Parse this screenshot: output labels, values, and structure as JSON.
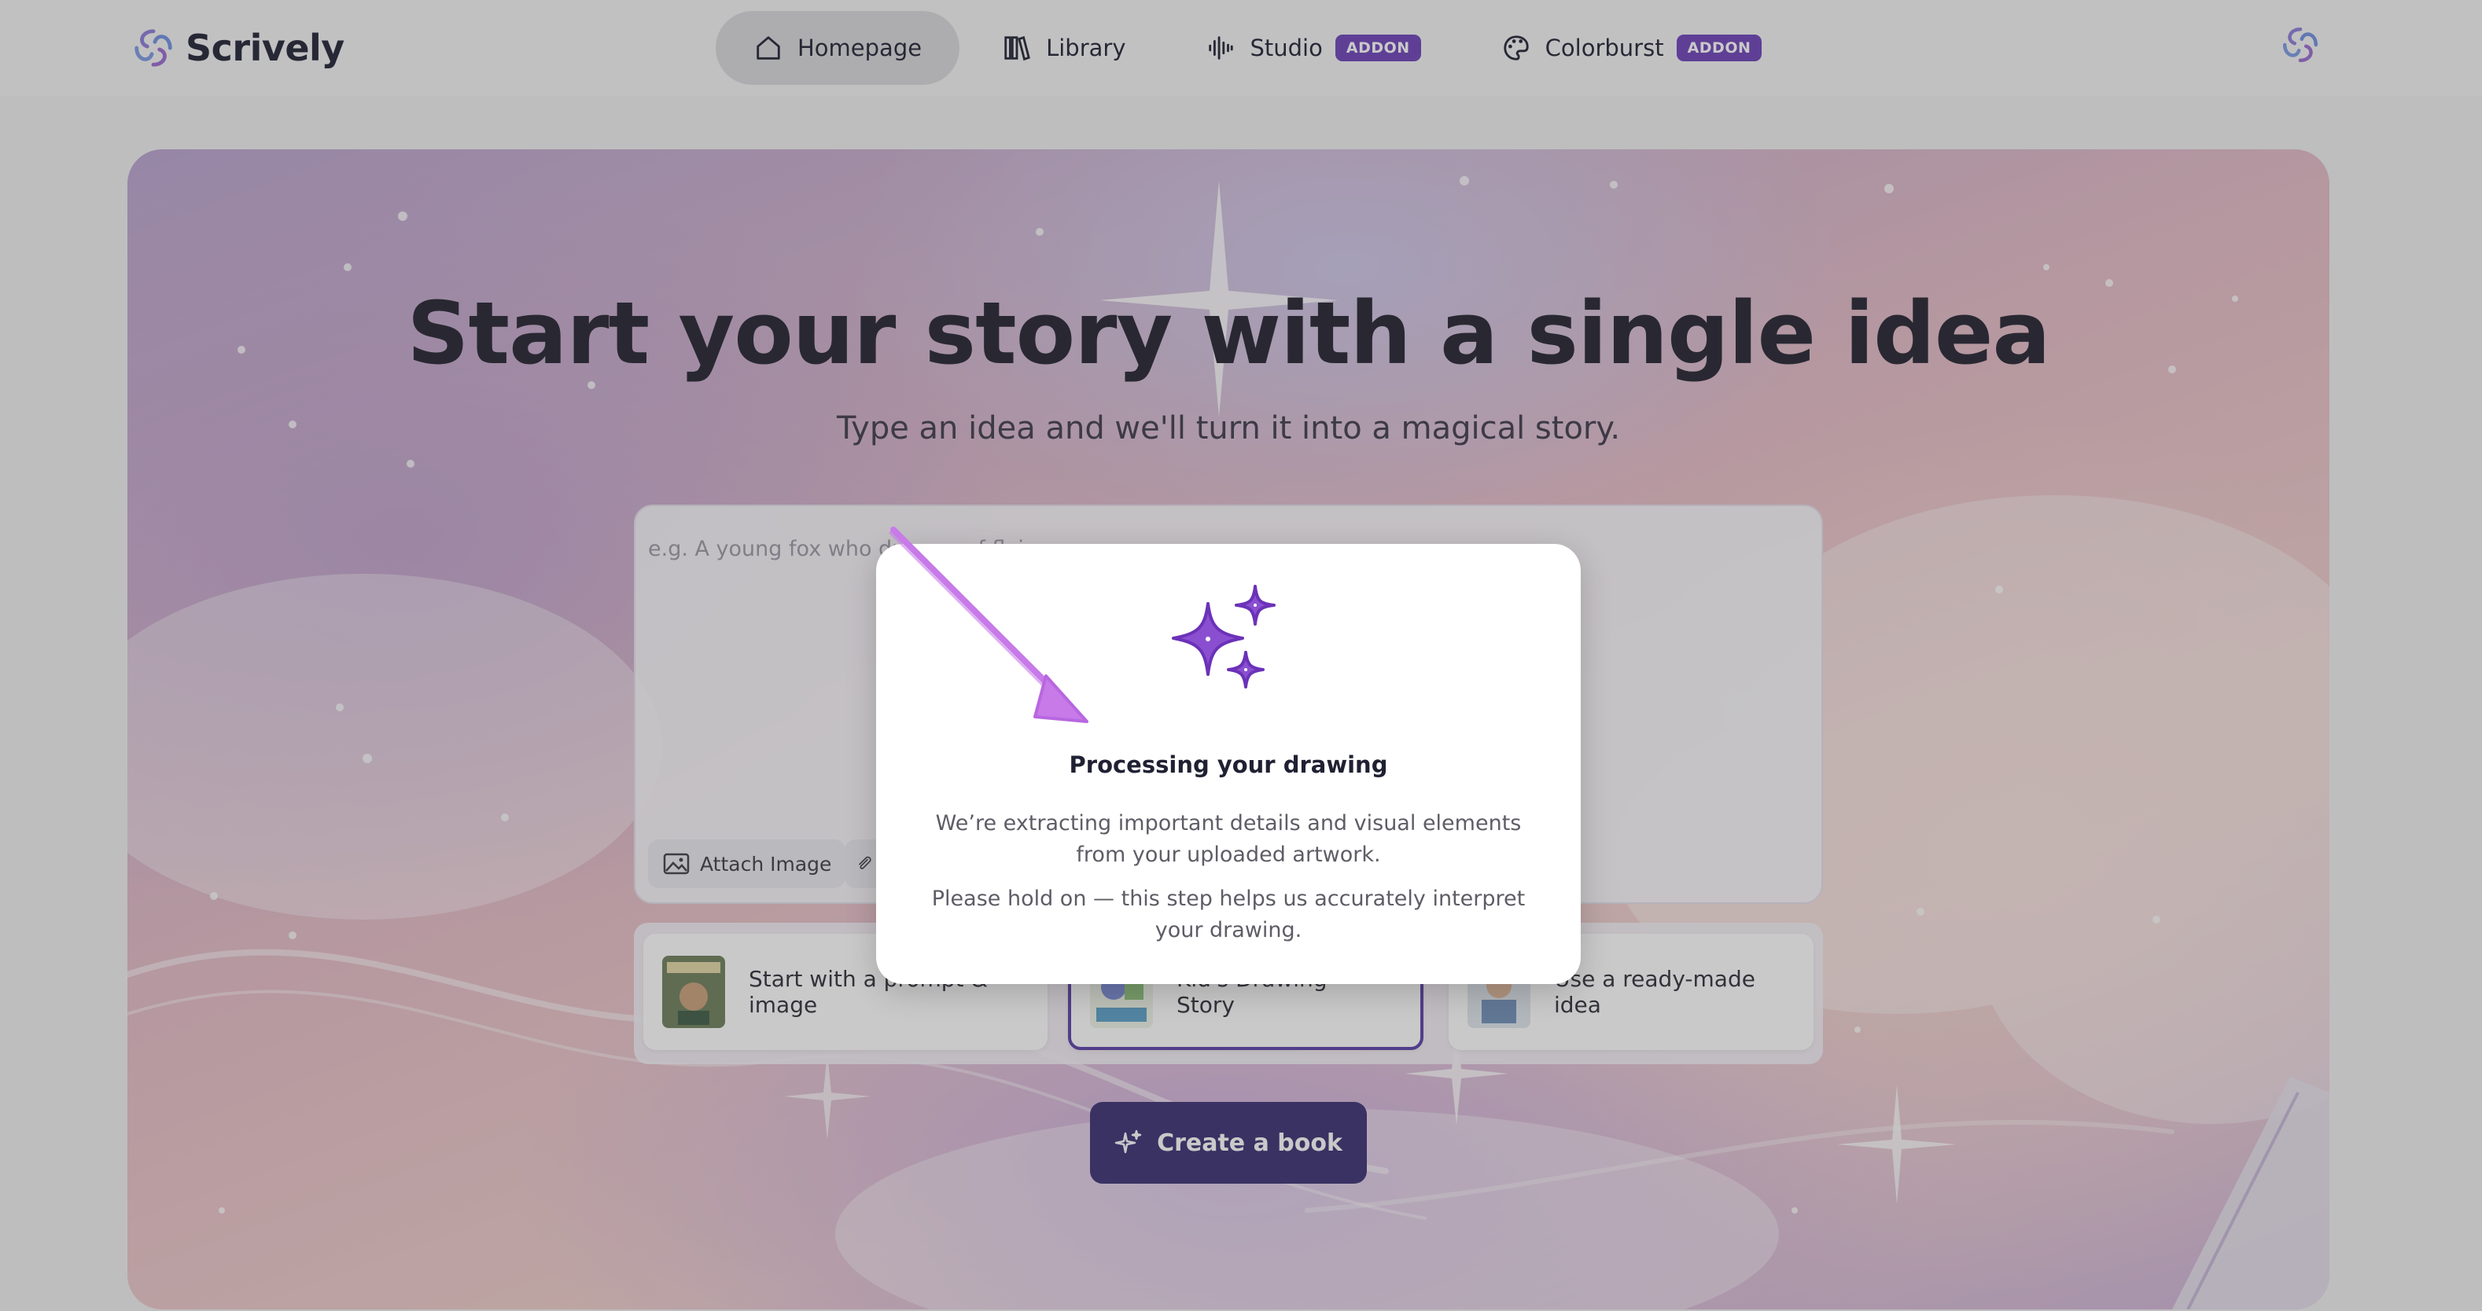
{
  "brand": {
    "name": "Scrively"
  },
  "nav": {
    "items": [
      {
        "label": "Homepage",
        "icon": "home-icon"
      },
      {
        "label": "Library",
        "icon": "library-icon"
      },
      {
        "label": "Studio",
        "icon": "audio-wave-icon",
        "badge": "ADDON"
      },
      {
        "label": "Colorburst",
        "icon": "palette-icon",
        "badge": "ADDON"
      }
    ]
  },
  "hero": {
    "title": "Start your story with a single idea",
    "subtitle": "Type an idea and we'll turn it into a magical story."
  },
  "prompt": {
    "placeholder": "e.g. A young fox who dreams of flying...",
    "attach_label": "Attach Image"
  },
  "modes": [
    {
      "label": "Start with a prompt & image"
    },
    {
      "label": "Kid's Drawing → Story"
    },
    {
      "label": "Use a ready-made idea"
    }
  ],
  "create_button": {
    "label": "Create a book"
  },
  "modal": {
    "title": "Processing your drawing",
    "line1": "We’re extracting important details and visual elements from your uploaded artwork.",
    "line2": "Please hold on — this step helps us accurately interpret your drawing."
  },
  "colors": {
    "accent": "#6b40b8",
    "button": "#3a2f72",
    "sparkle": "#8a4fd0"
  }
}
